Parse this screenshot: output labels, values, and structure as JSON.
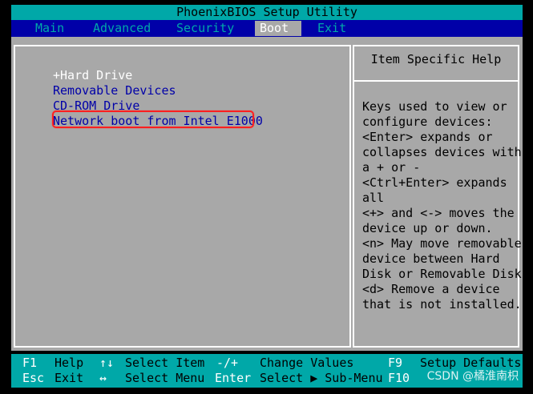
{
  "title": "PhoenixBIOS Setup Utility",
  "menu": [
    {
      "label": "Main",
      "active": false
    },
    {
      "label": "Advanced",
      "active": false
    },
    {
      "label": "Security",
      "active": false
    },
    {
      "label": "Boot",
      "active": true
    },
    {
      "label": "Exit",
      "active": false
    }
  ],
  "boot_items": [
    {
      "label": "+Hard Drive",
      "selected": true
    },
    {
      "label": "Removable Devices",
      "selected": false
    },
    {
      "label": "CD-ROM Drive",
      "selected": false
    },
    {
      "label": "Network boot from Intel E1000",
      "selected": false
    }
  ],
  "help": {
    "title": "Item Specific Help",
    "lines": [
      "Keys used to view or",
      "configure devices:",
      "<Enter> expands or",
      "collapses devices with",
      "a + or -",
      "<Ctrl+Enter> expands",
      "all",
      "<+> and <-> moves the",
      "device up or down.",
      "<n> May move removable",
      "device between Hard",
      "Disk or Removable Disk",
      "<d> Remove a device",
      "that is not installed."
    ]
  },
  "status": {
    "row1": [
      {
        "key": "F1",
        "desc": "Help"
      },
      {
        "key": "↑↓",
        "desc": "Select Item"
      },
      {
        "key": "-/+",
        "desc": "Change Values"
      },
      {
        "key": "F9",
        "desc": "Setup Defaults"
      }
    ],
    "row2": [
      {
        "key": "Esc",
        "desc": "Exit"
      },
      {
        "key": "↔",
        "desc": "Select Menu"
      },
      {
        "key": "Enter",
        "desc": "Select ▶ Sub-Menu"
      },
      {
        "key": "F10",
        "desc": ""
      }
    ]
  },
  "watermark": "CSDN @橘淮南枳",
  "colors": {
    "bios_blue": "#0000a8",
    "bios_cyan": "#00a8a8",
    "bios_gray": "#a8a8a8",
    "highlight_red": "#ff2020"
  }
}
